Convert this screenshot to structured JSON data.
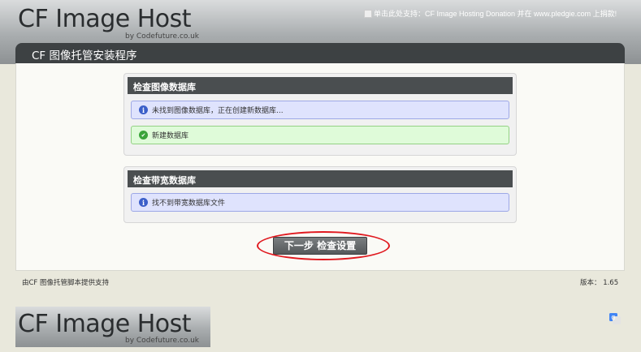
{
  "header": {
    "logo_main": "CF Image Host",
    "logo_sub": "by Codefuture.co.uk",
    "donation_text": "单击此处支持：CF Image Hosting Donation 并在 www.pledgie.com 上捐款!"
  },
  "titlebar": {
    "title": "CF 图像托管安装程序"
  },
  "panels": [
    {
      "heading": "检查图像数据库",
      "messages": [
        {
          "type": "info",
          "icon": "info-icon",
          "text": "未找到图像数据库，正在创建新数据库..."
        },
        {
          "type": "success",
          "icon": "check-icon",
          "text": "新建数据库"
        }
      ]
    },
    {
      "heading": "检查带宽数据库",
      "messages": [
        {
          "type": "info",
          "icon": "info-icon",
          "text": "找不到带宽数据库文件"
        }
      ]
    }
  ],
  "next_button": {
    "label": "下一步 检查设置"
  },
  "footer": {
    "powered_by": "由CF 图像托管脚本提供支持",
    "version": "版本： 1.65",
    "logo_main": "CF Image Host",
    "logo_sub": "by Codefuture.co.uk"
  },
  "colors": {
    "highlight": "#e0191f",
    "info_bg": "#dfe3fd",
    "success_bg": "#dffbd9",
    "panel_head": "#4a4e50"
  },
  "icons": {
    "translate": "translate-icon"
  }
}
